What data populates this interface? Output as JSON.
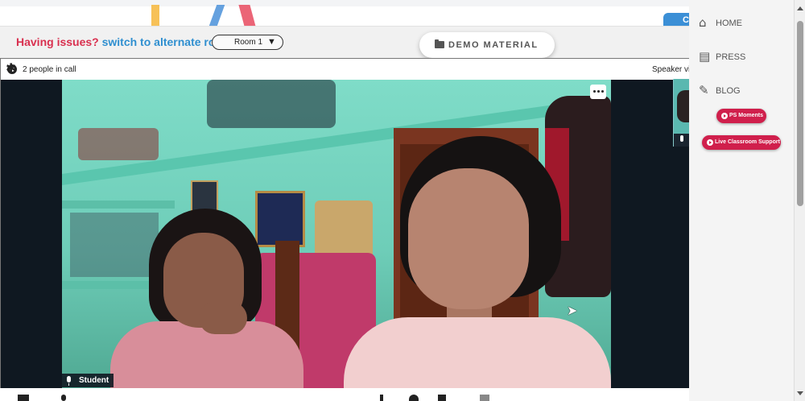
{
  "header": {
    "issue_prefix": "Having issues?",
    "issue_link": "switch to alternate room",
    "room_select_value": "Room 1",
    "room_select_arrow": "▼",
    "demo_material_label": "DEMO MATERIAL",
    "chat_bubble_text": "C"
  },
  "call": {
    "people_count_text": "2 people in call",
    "speaker_view_text": "Speaker vi",
    "participant_name": "Student",
    "settings_icon": "gear-icon",
    "video_menu_icon": "more-horizontal-icon"
  },
  "sidebar": {
    "items": [
      {
        "label": "HOME",
        "icon": "home-icon",
        "glyph": "⌂"
      },
      {
        "label": "PRESS",
        "icon": "newspaper-icon",
        "glyph": "▤"
      },
      {
        "label": "BLOG",
        "icon": "pencil-icon",
        "glyph": "✎"
      }
    ],
    "pills": [
      {
        "label": "PS Moments"
      },
      {
        "label": "Live Classroom Support"
      }
    ]
  },
  "colors": {
    "issue_red": "#d9304f",
    "issue_blue": "#2f8fd0",
    "pill_red": "#d01f4c",
    "video_bg": "#0f1821"
  }
}
